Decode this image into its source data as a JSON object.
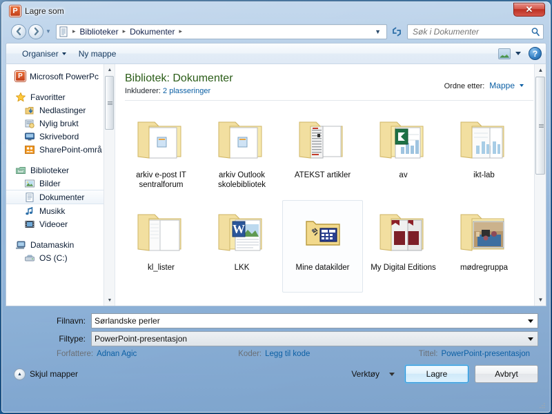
{
  "window": {
    "title": "Lagre som",
    "app_icon": "powerpoint-icon",
    "close_label": "✕"
  },
  "nav": {
    "back_icon": "back-arrow-icon",
    "forward_icon": "forward-arrow-icon",
    "history_icon": "chevron-down-icon",
    "address_icon": "document-icon",
    "breadcrumbs": [
      "Biblioteker",
      "Dokumenter"
    ],
    "breadcrumb_sep": "▸",
    "address_dropdown_icon": "chevron-down-icon",
    "refresh_icon": "refresh-icon",
    "search_placeholder": "Søk i Dokumenter",
    "search_icon": "search-icon"
  },
  "commandbar": {
    "organize_label": "Organiser",
    "new_folder_label": "Ny mappe",
    "view_icon": "view-mode-icon",
    "view_caret_icon": "chevron-down-icon",
    "help_label": "?"
  },
  "sidebar": {
    "items": [
      {
        "label": "Microsoft PowerPc",
        "icon": "powerpoint-icon",
        "level": "root",
        "selected": false
      },
      {
        "label": "Favoritter",
        "icon": "star-icon",
        "level": "root",
        "selected": false
      },
      {
        "label": "Nedlastinger",
        "icon": "downloads-icon",
        "level": "child",
        "selected": false
      },
      {
        "label": "Nylig brukt",
        "icon": "recent-icon",
        "level": "child",
        "selected": false
      },
      {
        "label": "Skrivebord",
        "icon": "desktop-icon",
        "level": "child",
        "selected": false
      },
      {
        "label": "SharePoint-områ",
        "icon": "sharepoint-icon",
        "level": "child",
        "selected": false
      },
      {
        "label": "Biblioteker",
        "icon": "libraries-icon",
        "level": "root",
        "selected": false
      },
      {
        "label": "Bilder",
        "icon": "pictures-icon",
        "level": "child",
        "selected": false
      },
      {
        "label": "Dokumenter",
        "icon": "documents-icon",
        "level": "child",
        "selected": true
      },
      {
        "label": "Musikk",
        "icon": "music-icon",
        "level": "child",
        "selected": false
      },
      {
        "label": "Videoer",
        "icon": "video-icon",
        "level": "child",
        "selected": false
      },
      {
        "label": "Datamaskin",
        "icon": "computer-icon",
        "level": "root",
        "selected": false
      },
      {
        "label": "OS (C:)",
        "icon": "harddisk-icon",
        "level": "child",
        "selected": false
      }
    ]
  },
  "content": {
    "library_title": "Bibliotek: Dokumenter",
    "includes_label": "Inkluderer:",
    "includes_value": "2 plasseringer",
    "arrange_label": "Ordne etter:",
    "arrange_value": "Mappe",
    "arrange_caret_icon": "chevron-down-icon",
    "items": [
      {
        "name": "arkiv e-post IT sentralforum",
        "icon": "folder-documents-icon",
        "hover": false
      },
      {
        "name": "arkiv Outlook skolebibliotek",
        "icon": "folder-documents-icon",
        "hover": false
      },
      {
        "name": "ATEKST artikler",
        "icon": "folder-newspaper-icon",
        "hover": false
      },
      {
        "name": "av",
        "icon": "folder-excel-icon",
        "hover": false
      },
      {
        "name": "ikt-lab",
        "icon": "folder-chart-icon",
        "hover": false
      },
      {
        "name": "kl_lister",
        "icon": "folder-blank-icon",
        "hover": false
      },
      {
        "name": "LKK",
        "icon": "folder-word-icon",
        "hover": false
      },
      {
        "name": "Mine datakilder",
        "icon": "folder-datasource-icon",
        "hover": true
      },
      {
        "name": "My Digital Editions",
        "icon": "folder-book-icon",
        "hover": false
      },
      {
        "name": "mødregruppa",
        "icon": "folder-photo-icon",
        "hover": false
      }
    ],
    "partial_row_count": 5
  },
  "form": {
    "filename_label": "Filnavn:",
    "filename_value": "Sørlandske perler",
    "filetype_label": "Filtype:",
    "filetype_value": "PowerPoint-presentasjon",
    "authors_label": "Forfattere:",
    "authors_value": "Adnan Agic",
    "tags_label": "Koder:",
    "tags_value": "Legg til kode",
    "title_label": "Tittel:",
    "title_value": "PowerPoint-presentasjon"
  },
  "footer": {
    "hide_folders_label": "Skjul mapper",
    "hide_folders_icon": "chevron-up-icon",
    "tools_label": "Verktøy",
    "tools_caret_icon": "chevron-down-icon",
    "save_label": "Lagre",
    "cancel_label": "Avbryt",
    "resize_grip_icon": "resize-grip-icon"
  },
  "colors": {
    "accent_blue": "#0b5fa4",
    "library_green": "#2a5c17",
    "close_red": "#bc2f21",
    "folder_yellow": "#f5e5a8"
  }
}
